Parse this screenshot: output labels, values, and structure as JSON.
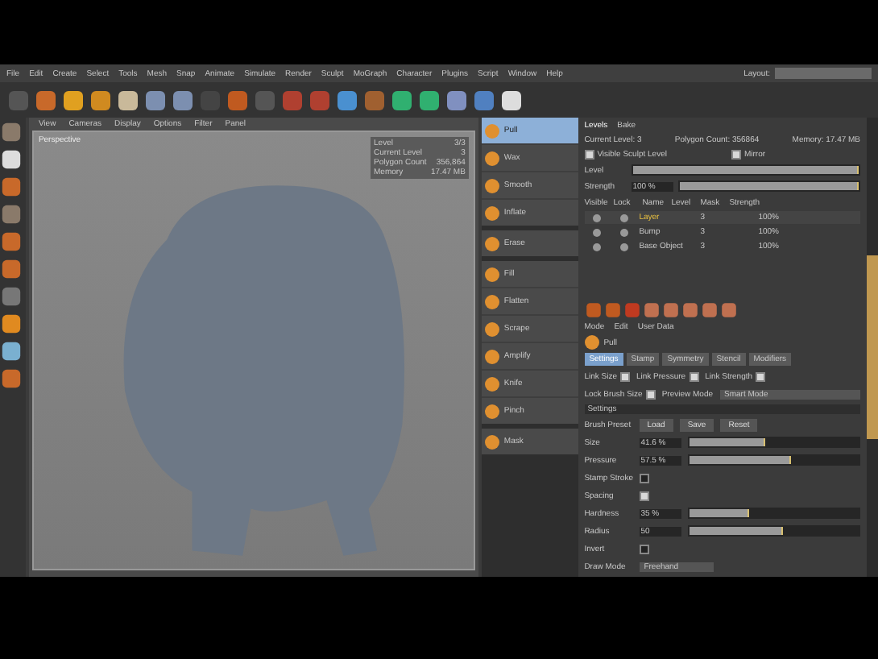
{
  "menu": [
    "File",
    "Edit",
    "Create",
    "Select",
    "Tools",
    "Mesh",
    "Snap",
    "Animate",
    "Simulate",
    "Render",
    "Sculpt",
    "MoGraph",
    "Character",
    "Plugins",
    "Script",
    "Window",
    "Help"
  ],
  "layout_label": "Layout:",
  "viewport": {
    "menu": [
      "View",
      "Cameras",
      "Display",
      "Options",
      "Filter",
      "Panel"
    ],
    "label": "Perspective",
    "hud": [
      {
        "label": "Level",
        "value": "3/3"
      },
      {
        "label": "Current Level",
        "value": "3"
      },
      {
        "label": "Polygon Count",
        "value": "356,864"
      },
      {
        "label": "Memory",
        "value": "17.47 MB"
      }
    ]
  },
  "brush_groups": [
    [
      {
        "name": "Pull",
        "selected": true
      },
      {
        "name": "Wax",
        "selected": false
      },
      {
        "name": "Smooth",
        "selected": false
      },
      {
        "name": "Inflate",
        "selected": false
      }
    ],
    [
      {
        "name": "Erase",
        "selected": false
      }
    ],
    [
      {
        "name": "Fill",
        "selected": false
      },
      {
        "name": "Flatten",
        "selected": false
      },
      {
        "name": "Scrape",
        "selected": false
      },
      {
        "name": "Amplify",
        "selected": false
      },
      {
        "name": "Knife",
        "selected": false
      },
      {
        "name": "Pinch",
        "selected": false
      }
    ],
    [
      {
        "name": "Mask",
        "selected": false
      }
    ]
  ],
  "levels": {
    "tabs": [
      {
        "label": "Levels",
        "selected": true
      },
      {
        "label": "Bake",
        "selected": false
      }
    ],
    "stats": [
      {
        "label": "Current Level:",
        "value": "3"
      },
      {
        "label": "Polygon Count:",
        "value": "356864"
      },
      {
        "label": "Memory:",
        "value": "17.47 MB"
      }
    ],
    "options": [
      {
        "label": "Visible Sculpt Level",
        "checked": true
      },
      {
        "label": "Mirror",
        "checked": true
      }
    ],
    "level_slider": {
      "label": "Level",
      "level": 1
    },
    "strength": {
      "label": "Strength",
      "value": "100 %",
      "level": 1
    },
    "columns": [
      "Visible",
      "Lock",
      "Name",
      "Level",
      "Mask",
      "Strength"
    ],
    "rows": [
      {
        "name": "Layer",
        "level": "3",
        "strength": "100%",
        "selected": true
      },
      {
        "name": "Bump",
        "level": "3",
        "strength": "100%",
        "selected": false
      },
      {
        "name": "Base Object",
        "level": "3",
        "strength": "100%",
        "selected": false
      }
    ]
  },
  "attributes": {
    "menu": [
      "Mode",
      "Edit",
      "User Data"
    ],
    "object": "Pull",
    "tabs": [
      {
        "label": "Settings",
        "selected": true
      },
      {
        "label": "Stamp",
        "selected": false
      },
      {
        "label": "Symmetry",
        "selected": false
      },
      {
        "label": "Stencil",
        "selected": false
      },
      {
        "label": "Modifiers",
        "selected": false
      }
    ],
    "links": [
      {
        "label": "Link Size",
        "checked": true
      },
      {
        "label": "Link Pressure",
        "checked": true
      },
      {
        "label": "Link Strength",
        "checked": true
      }
    ],
    "lock": {
      "label": "Lock Brush Size",
      "checked": true
    },
    "preview": {
      "label": "Preview Mode",
      "value": "Smart Mode"
    },
    "section": "Settings",
    "preset": {
      "label": "Brush Preset",
      "buttons": [
        "Load",
        "Save",
        "Reset"
      ]
    },
    "params": [
      {
        "kind": "slider",
        "label": "Size",
        "value": "41.6 %",
        "level": 0.45
      },
      {
        "kind": "slider",
        "label": "Pressure",
        "value": "57.5 %",
        "level": 0.6
      },
      {
        "kind": "check",
        "label": "Stamp Stroke",
        "checked": false
      },
      {
        "kind": "check",
        "label": "Spacing",
        "checked": true
      },
      {
        "kind": "slider",
        "label": "Hardness",
        "value": "35 %",
        "level": 0.35
      },
      {
        "kind": "slider",
        "label": "Radius",
        "value": "50",
        "level": 0.55
      },
      {
        "kind": "check",
        "label": "Invert",
        "checked": false
      },
      {
        "kind": "select",
        "label": "Draw Mode",
        "value": "Freehand"
      }
    ]
  }
}
